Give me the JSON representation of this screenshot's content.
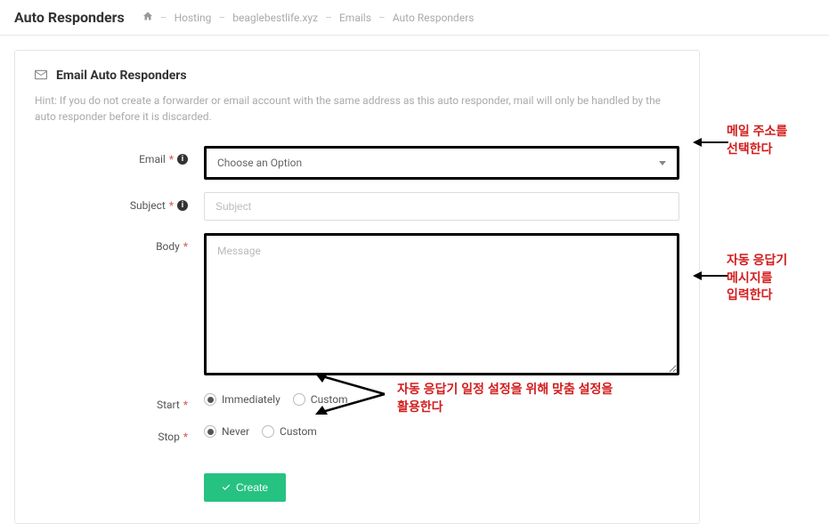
{
  "header": {
    "title": "Auto Responders",
    "breadcrumb": {
      "hosting": "Hosting",
      "domain": "beaglebestlife.xyz",
      "emails": "Emails",
      "current": "Auto Responders"
    }
  },
  "panel": {
    "title": "Email Auto Responders",
    "hint": "Hint: If you do not create a forwarder or email account with the same address as this auto responder, mail will only be handled by the auto responder before it is discarded."
  },
  "form": {
    "email_label": "Email",
    "email_placeholder": "Choose an Option",
    "subject_label": "Subject",
    "subject_placeholder": "Subject",
    "body_label": "Body",
    "body_placeholder": "Message",
    "start_label": "Start",
    "start_options": {
      "immediately": "Immediately",
      "custom": "Custom"
    },
    "stop_label": "Stop",
    "stop_options": {
      "never": "Never",
      "custom": "Custom"
    },
    "create_button": "Create"
  },
  "annotations": {
    "email_note": "메일 주소를\n선택한다",
    "body_note": "자동 응답기\n메시지를\n입력한다",
    "schedule_note": "자동 응답기 일정 설정을 위해 맞춤 설정을\n활용한다"
  }
}
